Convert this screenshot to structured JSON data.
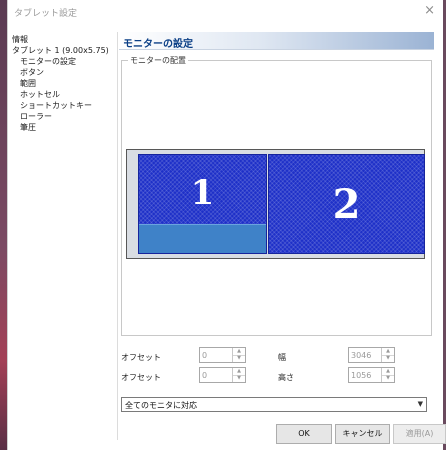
{
  "window": {
    "title": "タブレット設定",
    "close_glyph": "×"
  },
  "tree": {
    "items": [
      {
        "label": "情報"
      },
      {
        "label": "タブレット 1 (9.00x5.75)"
      },
      {
        "label": "モニターの設定"
      },
      {
        "label": "ボタン"
      },
      {
        "label": "範囲"
      },
      {
        "label": "ホットセル"
      },
      {
        "label": "ショートカットキー"
      },
      {
        "label": "ローラー"
      },
      {
        "label": "筆圧"
      }
    ]
  },
  "panel": {
    "title": "モニターの設定"
  },
  "monitor_group": {
    "label": "モニターの配置"
  },
  "monitors": [
    {
      "number": "1"
    },
    {
      "number": "2"
    }
  ],
  "fields": {
    "offset_x": {
      "label": "オフセット",
      "value": "0"
    },
    "offset_y": {
      "label": "オフセット",
      "value": "0"
    },
    "width": {
      "label": "幅",
      "value": "3046"
    },
    "height": {
      "label": "高さ",
      "value": "1056"
    }
  },
  "mapping_select": {
    "value": "全てのモニタに対応"
  },
  "buttons": {
    "ok": "OK",
    "cancel": "キャンセル",
    "apply": "適用(A)"
  },
  "colors": {
    "monitor_fill": "#1e30c8",
    "tablet_area": "#3f82c8",
    "header_text": "#0b3f86"
  }
}
